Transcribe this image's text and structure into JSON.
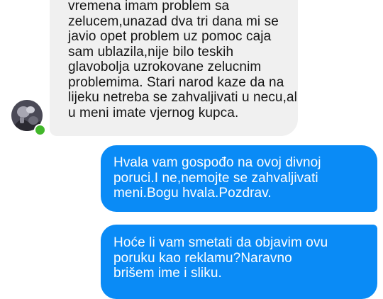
{
  "conversation": {
    "incoming_message": {
      "lines": [
        "vremena imam problem sa",
        "zelucem,unazad dva tri dana mi se",
        "javio opet problem uz pomoc caja",
        "sam ublazila,nije bilo teskih",
        "glavobolja uzrokovane zelucnim",
        "problemima. Stari narod kaze da na",
        "lijeku netreba se zahvaljivati u necu,al",
        "u meni imate vjernog kupca."
      ]
    },
    "outgoing_messages": [
      {
        "lines": [
          "Hvala vam gospođo na ovoj divnoj",
          "poruci.I ne,nemojte se zahvaljivati",
          "meni.Bogu hvala.Pozdrav."
        ]
      },
      {
        "lines": [
          "Hoće li vam smetati da objavim ovu",
          "poruku kao reklamu?Naravno",
          "brišem ime i sliku."
        ]
      }
    ],
    "colors": {
      "incoming_bubble": "#f0f0f0",
      "outgoing_bubble": "#0a8bf6",
      "online_indicator": "#42b72a"
    },
    "icons": {
      "avatar": "contact-avatar",
      "status": "online-status-dot"
    }
  }
}
